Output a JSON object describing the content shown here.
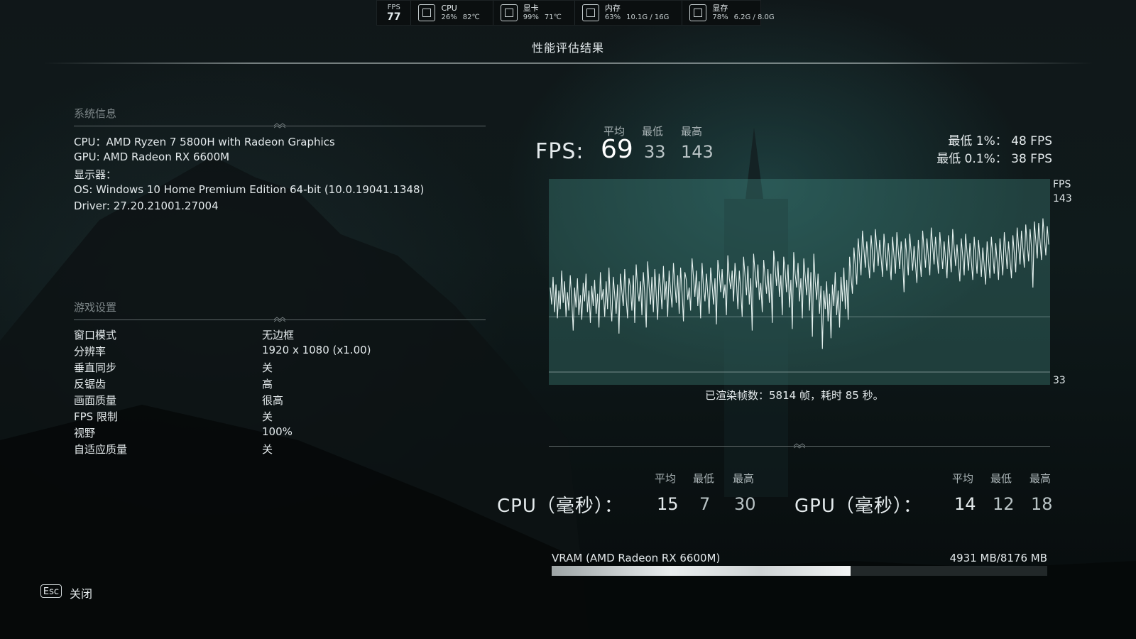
{
  "overlay": {
    "fps": {
      "label": "FPS",
      "value": "77"
    },
    "cpu": {
      "label": "CPU",
      "usage": "26%",
      "temp": "82℃"
    },
    "gpu": {
      "label": "显卡",
      "usage": "99%",
      "temp": "71℃"
    },
    "ram": {
      "label": "内存",
      "usage": "63%",
      "amount": "10.1G / 16G"
    },
    "vram": {
      "label": "显存",
      "usage": "78%",
      "amount": "6.2G / 8.0G"
    }
  },
  "page_title": "性能评估结果",
  "system_info": {
    "heading": "系统信息",
    "lines": [
      "CPU：AMD Ryzen 7 5800H with Radeon Graphics",
      "GPU: AMD Radeon RX 6600M",
      "显示器：",
      "OS: Windows 10 Home Premium Edition 64-bit (10.0.19041.1348)",
      "Driver: 27.20.21001.27004"
    ]
  },
  "game_settings": {
    "heading": "游戏设置",
    "rows": [
      {
        "label": "窗口模式",
        "value": "无边框"
      },
      {
        "label": "分辨率",
        "value": "1920 x 1080 (x1.00)"
      },
      {
        "label": "垂直同步",
        "value": "关"
      },
      {
        "label": "反锯齿",
        "value": "高"
      },
      {
        "label": "画面质量",
        "value": "很高"
      },
      {
        "label": "FPS 限制",
        "value": "关"
      },
      {
        "label": "视野",
        "value": "100%"
      },
      {
        "label": "自适应质量",
        "value": "关"
      }
    ]
  },
  "fps_stats": {
    "label": "FPS:",
    "headers": {
      "avg": "平均",
      "min": "最低",
      "max": "最高"
    },
    "avg": "69",
    "min": "33",
    "max": "143",
    "low_1": "最低 1%： 48 FPS",
    "low_01": "最低 0.1%： 38 FPS"
  },
  "chart_data": {
    "type": "line",
    "ylabel": "FPS",
    "y_tick_labels": [
      "143",
      "33"
    ],
    "ylim": [
      33,
      143
    ],
    "average_line": 69,
    "grid": false,
    "series": [
      {
        "values": [
          88,
          77,
          95,
          72,
          90,
          68,
          86,
          74,
          99,
          78,
          92,
          69,
          85,
          73,
          96,
          80,
          60,
          88,
          75,
          94,
          70,
          83,
          67,
          91,
          79,
          97,
          72,
          86,
          65,
          89,
          76,
          93,
          71,
          84,
          62,
          98,
          80,
          87,
          69,
          92,
          74,
          101,
          78,
          66,
          95,
          83,
          71,
          90,
          58,
          97,
          85,
          76,
          100,
          81,
          68,
          94,
          88,
          73,
          96,
          65,
          103,
          86,
          79,
          92,
          70,
          98,
          84,
          62,
          105,
          89,
          77,
          95,
          72,
          100,
          83,
          67,
          97,
          88,
          74,
          102,
          80,
          92,
          69,
          99,
          86,
          75,
          104,
          90,
          78,
          96,
          71,
          101,
          85,
          66,
          98,
          93,
          80,
          88,
          73,
          107,
          95,
          82,
          99,
          76,
          92,
          68,
          104,
          88,
          79,
          97,
          84,
          71,
          101,
          90,
          77,
          94,
          64,
          106,
          98,
          85,
          100,
          81,
          90,
          70,
          109,
          94,
          87,
          99,
          79,
          104,
          92,
          74,
          99,
          86,
          69,
          108,
          96,
          83,
          102,
          77,
          94,
          60,
          110,
          98,
          88,
          103,
          80,
          91,
          72,
          106,
          95,
          84,
          100,
          78,
          97,
          65,
          112,
          101,
          89,
          105,
          82,
          96,
          70,
          108,
          99,
          85,
          103,
          75,
          93,
          61,
          111,
          97,
          88,
          104,
          79,
          94,
          68,
          107,
          95,
          83,
          101,
          73,
          98,
          56,
          110,
          92,
          80,
          97,
          71,
          89,
          48,
          86,
          74,
          92,
          66,
          84,
          55,
          90,
          76,
          98,
          70,
          86,
          62,
          95,
          79,
          101,
          74,
          93,
          67,
          108,
          95,
          84,
          114,
          102,
          90,
          120,
          108,
          96,
          125,
          113,
          101,
          118,
          106,
          94,
          122,
          110,
          98,
          126,
          114,
          102,
          119,
          107,
          95,
          123,
          111,
          99,
          117,
          105,
          93,
          121,
          109,
          97,
          124,
          112,
          100,
          118,
          106,
          85,
          120,
          108,
          96,
          123,
          111,
          99,
          115,
          103,
          91,
          119,
          107,
          95,
          125,
          113,
          101,
          120,
          108,
          96,
          127,
          115,
          103,
          121,
          109,
          97,
          124,
          112,
          100,
          118,
          106,
          94,
          122,
          110,
          98,
          126,
          114,
          102,
          116,
          104,
          92,
          120,
          108,
          96,
          123,
          111,
          99,
          117,
          105,
          93,
          121,
          109,
          97,
          119,
          107,
          95,
          114,
          102,
          90,
          118,
          106,
          94,
          121,
          109,
          97,
          117,
          105,
          93,
          120,
          108,
          96,
          124,
          112,
          100,
          118,
          106,
          94,
          122,
          110,
          98,
          127,
          115,
          103,
          125,
          113,
          101,
          129,
          117,
          105,
          126,
          114,
          88,
          131,
          119,
          107,
          130,
          118,
          106,
          133,
          121,
          109,
          128,
          116
        ]
      }
    ]
  },
  "frames_text": "已渲染帧数：5814 帧，耗时 85 秒。",
  "cpu_ms": {
    "label": "CPU（毫秒）：",
    "headers": {
      "avg": "平均",
      "min": "最低",
      "max": "最高"
    },
    "avg": "15",
    "min": "7",
    "max": "30"
  },
  "gpu_ms": {
    "label": "GPU（毫秒）：",
    "headers": {
      "avg": "平均",
      "min": "最低",
      "max": "最高"
    },
    "avg": "14",
    "min": "12",
    "max": "18"
  },
  "vram_usage": {
    "label": "VRAM (AMD Radeon RX 6600M)",
    "value": "4931 MB/8176 MB",
    "used_mb": 4931,
    "total_mb": 8176
  },
  "footer": {
    "key": "Esc",
    "label": "关闭"
  }
}
